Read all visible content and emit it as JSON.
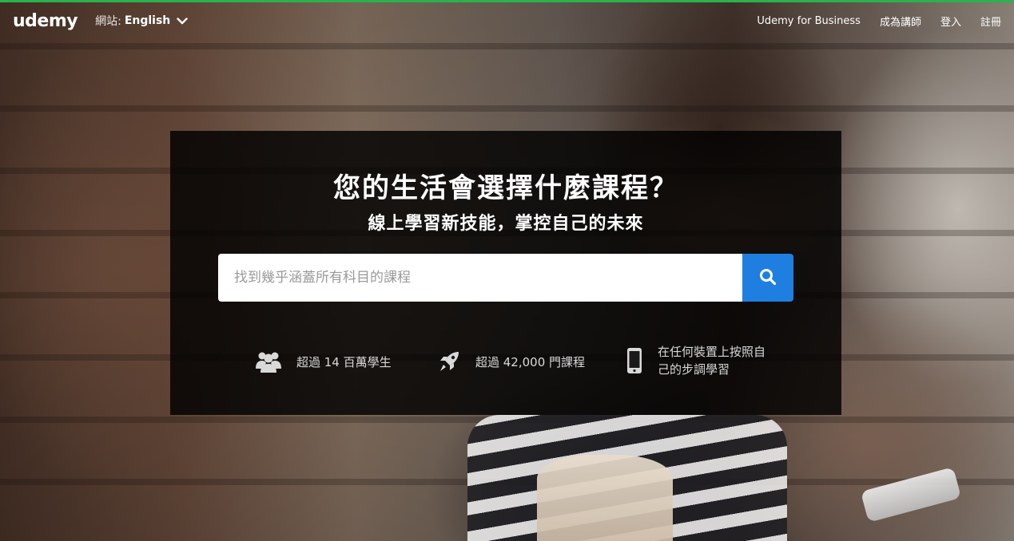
{
  "header": {
    "logo": "udemy",
    "site_label": "網站:",
    "site_value": "English",
    "nav": [
      {
        "label": "Udemy for Business"
      },
      {
        "label": "成為講師"
      },
      {
        "label": "登入"
      },
      {
        "label": "註冊"
      }
    ]
  },
  "hero": {
    "title": "您的生活會選擇什麼課程？",
    "subtitle": "線上學習新技能，掌控自己的未來",
    "search_placeholder": "找到幾乎涵蓋所有科目的課程"
  },
  "stats": [
    {
      "icon": "students-icon",
      "text": "超過 14 百萬學生"
    },
    {
      "icon": "rocket-icon",
      "text": "超過 42,000 門課程"
    },
    {
      "icon": "mobile-device-icon",
      "text": "在任何裝置上按照自己的步調學習"
    }
  ],
  "colors": {
    "accent": "#1f7fe0",
    "top_bar": "#2ab24b"
  }
}
